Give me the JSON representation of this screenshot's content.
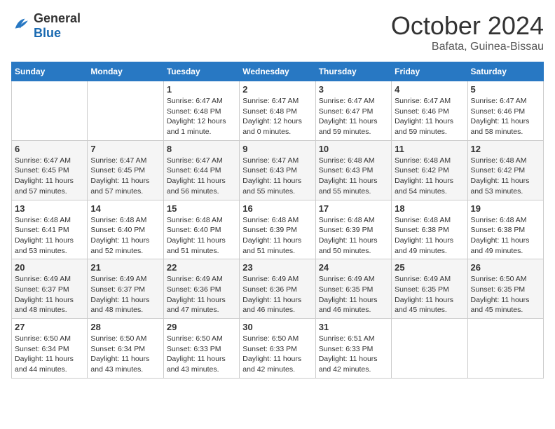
{
  "header": {
    "logo_general": "General",
    "logo_blue": "Blue",
    "month_title": "October 2024",
    "location": "Bafata, Guinea-Bissau"
  },
  "weekdays": [
    "Sunday",
    "Monday",
    "Tuesday",
    "Wednesday",
    "Thursday",
    "Friday",
    "Saturday"
  ],
  "weeks": [
    [
      {
        "day": "",
        "info": ""
      },
      {
        "day": "",
        "info": ""
      },
      {
        "day": "1",
        "sunrise": "6:47 AM",
        "sunset": "6:48 PM",
        "daylight": "12 hours and 1 minute."
      },
      {
        "day": "2",
        "sunrise": "6:47 AM",
        "sunset": "6:48 PM",
        "daylight": "12 hours and 0 minutes."
      },
      {
        "day": "3",
        "sunrise": "6:47 AM",
        "sunset": "6:47 PM",
        "daylight": "11 hours and 59 minutes."
      },
      {
        "day": "4",
        "sunrise": "6:47 AM",
        "sunset": "6:46 PM",
        "daylight": "11 hours and 59 minutes."
      },
      {
        "day": "5",
        "sunrise": "6:47 AM",
        "sunset": "6:46 PM",
        "daylight": "11 hours and 58 minutes."
      }
    ],
    [
      {
        "day": "6",
        "sunrise": "6:47 AM",
        "sunset": "6:45 PM",
        "daylight": "11 hours and 57 minutes."
      },
      {
        "day": "7",
        "sunrise": "6:47 AM",
        "sunset": "6:45 PM",
        "daylight": "11 hours and 57 minutes."
      },
      {
        "day": "8",
        "sunrise": "6:47 AM",
        "sunset": "6:44 PM",
        "daylight": "11 hours and 56 minutes."
      },
      {
        "day": "9",
        "sunrise": "6:47 AM",
        "sunset": "6:43 PM",
        "daylight": "11 hours and 55 minutes."
      },
      {
        "day": "10",
        "sunrise": "6:48 AM",
        "sunset": "6:43 PM",
        "daylight": "11 hours and 55 minutes."
      },
      {
        "day": "11",
        "sunrise": "6:48 AM",
        "sunset": "6:42 PM",
        "daylight": "11 hours and 54 minutes."
      },
      {
        "day": "12",
        "sunrise": "6:48 AM",
        "sunset": "6:42 PM",
        "daylight": "11 hours and 53 minutes."
      }
    ],
    [
      {
        "day": "13",
        "sunrise": "6:48 AM",
        "sunset": "6:41 PM",
        "daylight": "11 hours and 53 minutes."
      },
      {
        "day": "14",
        "sunrise": "6:48 AM",
        "sunset": "6:40 PM",
        "daylight": "11 hours and 52 minutes."
      },
      {
        "day": "15",
        "sunrise": "6:48 AM",
        "sunset": "6:40 PM",
        "daylight": "11 hours and 51 minutes."
      },
      {
        "day": "16",
        "sunrise": "6:48 AM",
        "sunset": "6:39 PM",
        "daylight": "11 hours and 51 minutes."
      },
      {
        "day": "17",
        "sunrise": "6:48 AM",
        "sunset": "6:39 PM",
        "daylight": "11 hours and 50 minutes."
      },
      {
        "day": "18",
        "sunrise": "6:48 AM",
        "sunset": "6:38 PM",
        "daylight": "11 hours and 49 minutes."
      },
      {
        "day": "19",
        "sunrise": "6:48 AM",
        "sunset": "6:38 PM",
        "daylight": "11 hours and 49 minutes."
      }
    ],
    [
      {
        "day": "20",
        "sunrise": "6:49 AM",
        "sunset": "6:37 PM",
        "daylight": "11 hours and 48 minutes."
      },
      {
        "day": "21",
        "sunrise": "6:49 AM",
        "sunset": "6:37 PM",
        "daylight": "11 hours and 48 minutes."
      },
      {
        "day": "22",
        "sunrise": "6:49 AM",
        "sunset": "6:36 PM",
        "daylight": "11 hours and 47 minutes."
      },
      {
        "day": "23",
        "sunrise": "6:49 AM",
        "sunset": "6:36 PM",
        "daylight": "11 hours and 46 minutes."
      },
      {
        "day": "24",
        "sunrise": "6:49 AM",
        "sunset": "6:35 PM",
        "daylight": "11 hours and 46 minutes."
      },
      {
        "day": "25",
        "sunrise": "6:49 AM",
        "sunset": "6:35 PM",
        "daylight": "11 hours and 45 minutes."
      },
      {
        "day": "26",
        "sunrise": "6:50 AM",
        "sunset": "6:35 PM",
        "daylight": "11 hours and 45 minutes."
      }
    ],
    [
      {
        "day": "27",
        "sunrise": "6:50 AM",
        "sunset": "6:34 PM",
        "daylight": "11 hours and 44 minutes."
      },
      {
        "day": "28",
        "sunrise": "6:50 AM",
        "sunset": "6:34 PM",
        "daylight": "11 hours and 43 minutes."
      },
      {
        "day": "29",
        "sunrise": "6:50 AM",
        "sunset": "6:33 PM",
        "daylight": "11 hours and 43 minutes."
      },
      {
        "day": "30",
        "sunrise": "6:50 AM",
        "sunset": "6:33 PM",
        "daylight": "11 hours and 42 minutes."
      },
      {
        "day": "31",
        "sunrise": "6:51 AM",
        "sunset": "6:33 PM",
        "daylight": "11 hours and 42 minutes."
      },
      {
        "day": "",
        "info": ""
      },
      {
        "day": "",
        "info": ""
      }
    ]
  ],
  "labels": {
    "sunrise": "Sunrise:",
    "sunset": "Sunset:",
    "daylight": "Daylight:"
  }
}
